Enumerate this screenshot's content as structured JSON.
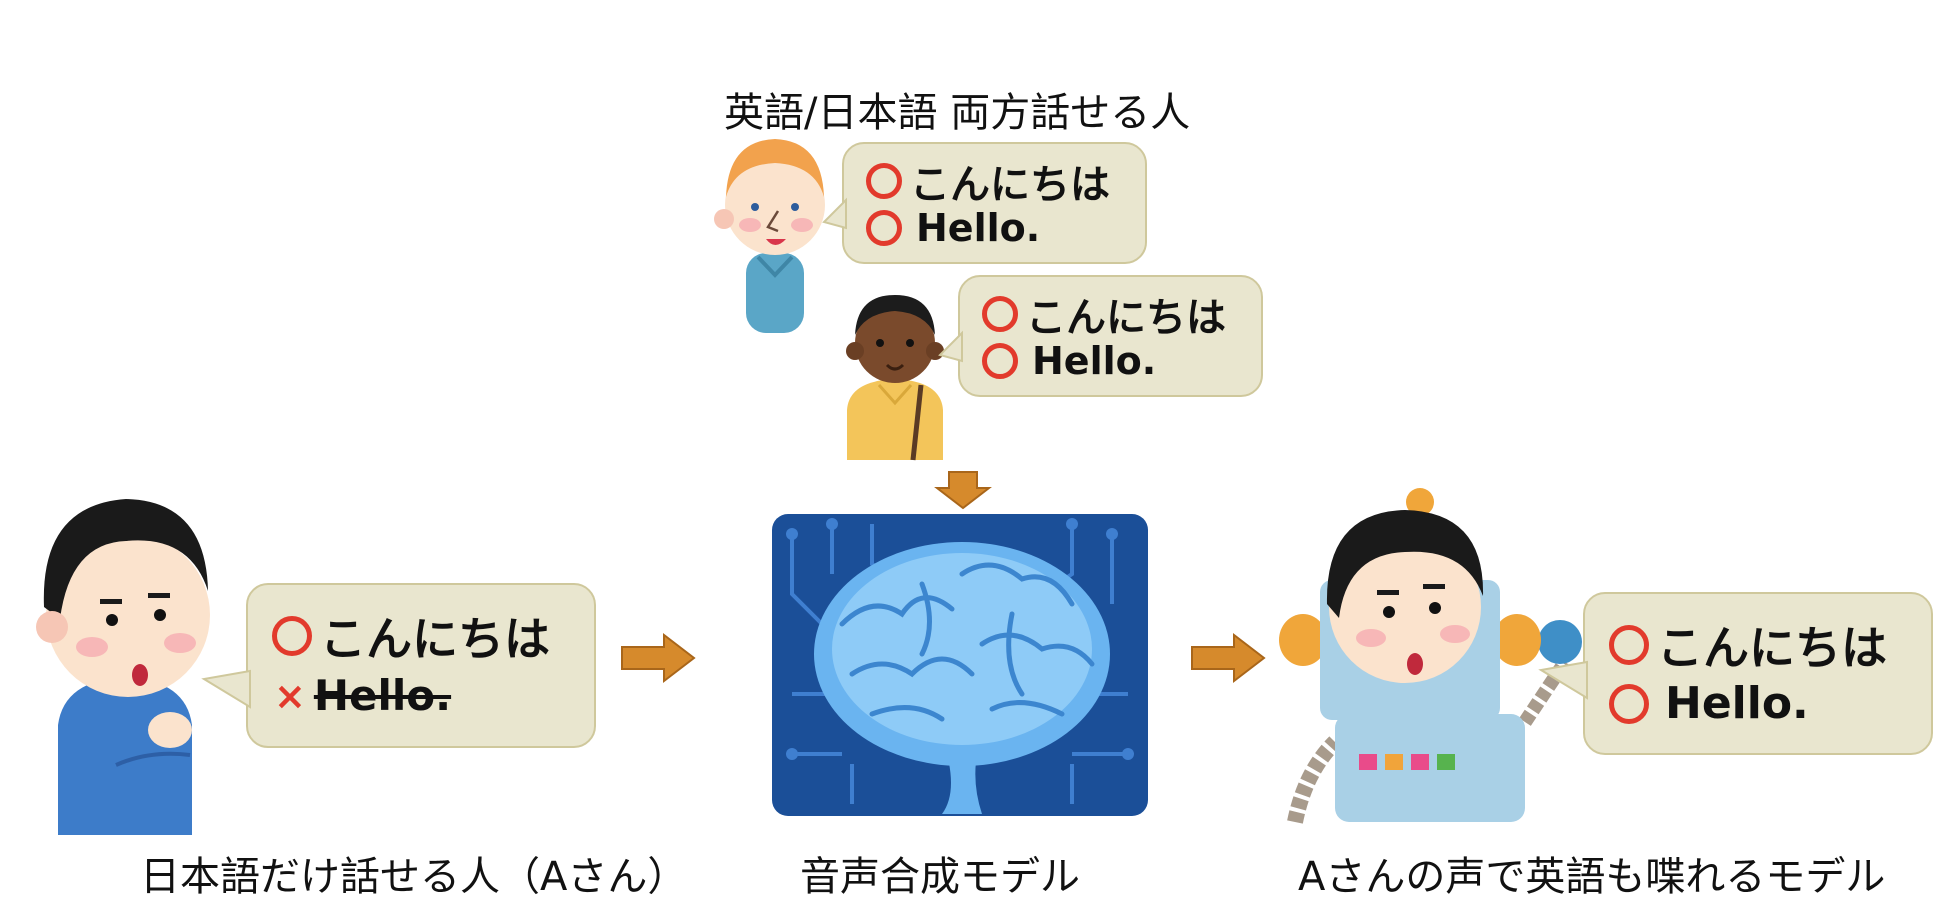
{
  "labels": {
    "top_group": "英語/日本語 両方話せる人",
    "left_person": "日本語だけ話せる人（Aさん）",
    "model": "音声合成モデル",
    "right_model": "Aさんの声で英語も喋れるモデル"
  },
  "speech": {
    "japanese_greeting": "こんにちは",
    "english_greeting": "Hello.",
    "can_speak_mark": "○",
    "cannot_speak_mark": "×"
  },
  "colors": {
    "ok_mark": "#e23a2c",
    "bubble_fill": "#e9e6cf",
    "bubble_border": "#cfc89c",
    "arrow": "#d68a2c",
    "chip_blue": "#1b4f98"
  }
}
